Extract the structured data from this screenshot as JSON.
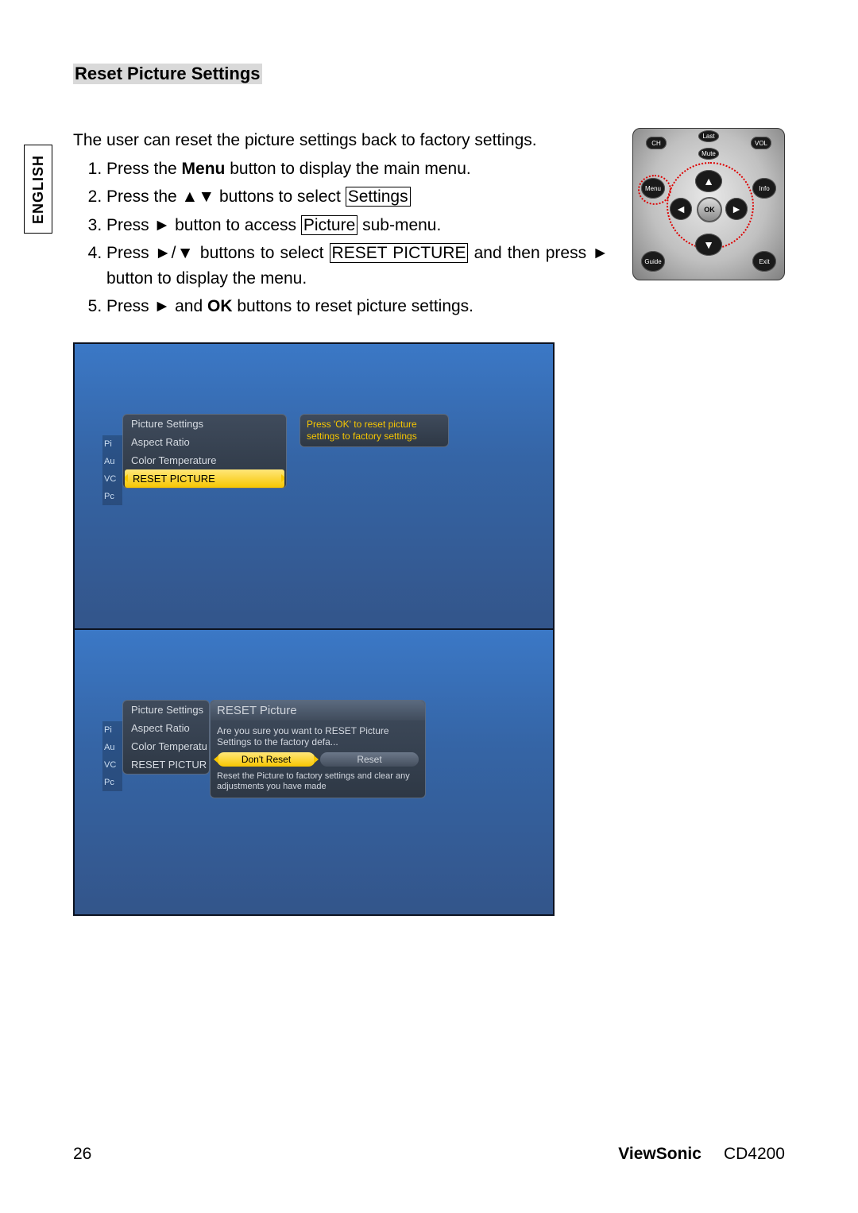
{
  "language_tab": "ENGLISH",
  "title": "Reset Picture Settings",
  "intro": "The user can reset the picture settings back to factory settings.",
  "steps": {
    "s1a": "Press the ",
    "s1b": "Menu",
    "s1c": " button to display the main menu.",
    "s2a": "Press the ▲▼ buttons to select ",
    "s2b": "Settings",
    "s3a": "Press ► button to access ",
    "s3b": "Picture",
    "s3c": " sub-menu.",
    "s4a": "Press ►/▼ buttons to select ",
    "s4b": "RESET PICTURE",
    "s4c": " and then press ► button to display the menu.",
    "s5a": "Press ► and ",
    "s5b": "OK",
    "s5c": " buttons to reset picture settings."
  },
  "remote": {
    "ch": "CH",
    "vol": "VOL",
    "last": "Last",
    "mute": "Mute",
    "menu": "Menu",
    "info": "Info",
    "guide": "Guide",
    "exit": "Exit",
    "ok": "OK",
    "up": "▲",
    "down": "▼",
    "left": "◄",
    "right": "►"
  },
  "side": {
    "pi": "Pi",
    "au": "Au",
    "vc": "VC",
    "pc": "Pc"
  },
  "screen1": {
    "menu": [
      "Picture Settings",
      "Aspect Ratio",
      "Color Temperature",
      "RESET PICTURE"
    ],
    "hint": "Press 'OK' to reset picture settings to factory settings"
  },
  "screen2": {
    "menu": [
      "Picture Settings",
      "Aspect Ratio",
      "Color Temperatu",
      "RESET PICTUR"
    ],
    "dialog": {
      "title": "RESET Picture",
      "question": "Are you sure you want to RESET Picture Settings to the factory defa...",
      "btn_dont": "Don't Reset",
      "btn_reset": "Reset",
      "desc": "Reset the Picture to factory settings and clear any adjustments you have made"
    }
  },
  "footer": {
    "page": "26",
    "brand": "ViewSonic",
    "model": "CD4200"
  }
}
